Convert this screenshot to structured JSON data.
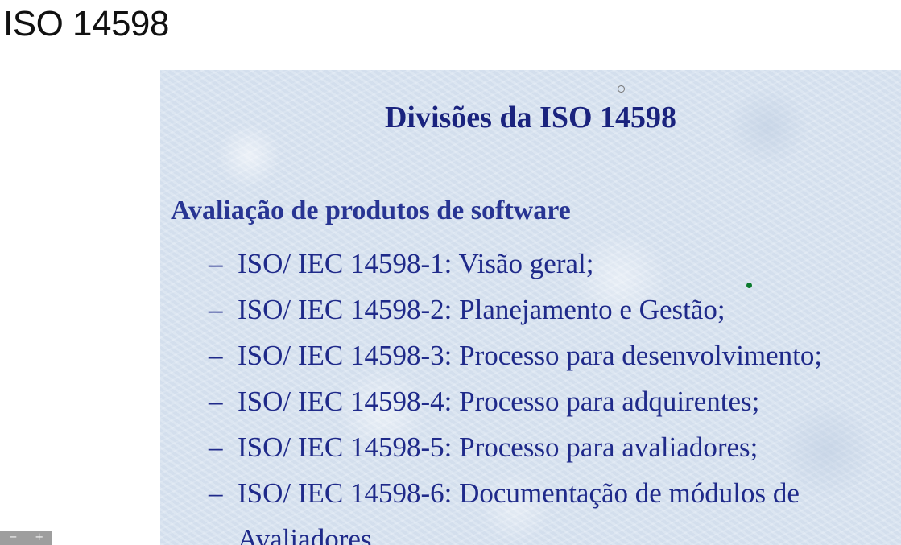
{
  "page": {
    "title": "ISO 14598"
  },
  "slide": {
    "heading": "Divisões da ISO 14598",
    "section_heading": "Avaliação de produtos de software",
    "bullet_marker": "–",
    "items": [
      {
        "text": "ISO/ IEC 14598-1: Visão geral;"
      },
      {
        "text": "ISO/ IEC 14598-2: Planejamento e Gestão;"
      },
      {
        "text": "ISO/ IEC 14598-3: Processo para desenvolvimento;"
      },
      {
        "text": "ISO/ IEC 14598-4: Processo para adquirentes;"
      },
      {
        "text": "ISO/ IEC 14598-5: Processo para avaliadores;"
      },
      {
        "text": "ISO/ IEC 14598-6: Documentação de módulos de",
        "continuation": "Avaliadores."
      }
    ]
  },
  "zoom": {
    "minus_label": "−",
    "plus_label": "+"
  },
  "colors": {
    "slide_background": "#dce6f2",
    "heading": "#1a237e",
    "section_heading": "#283593",
    "bullet_text": "#1f2a8a",
    "laser_dot": "#0b7a2e"
  },
  "icons": {
    "cursor": "cursor-ring-icon",
    "laser_pointer": "laser-dot-icon"
  }
}
